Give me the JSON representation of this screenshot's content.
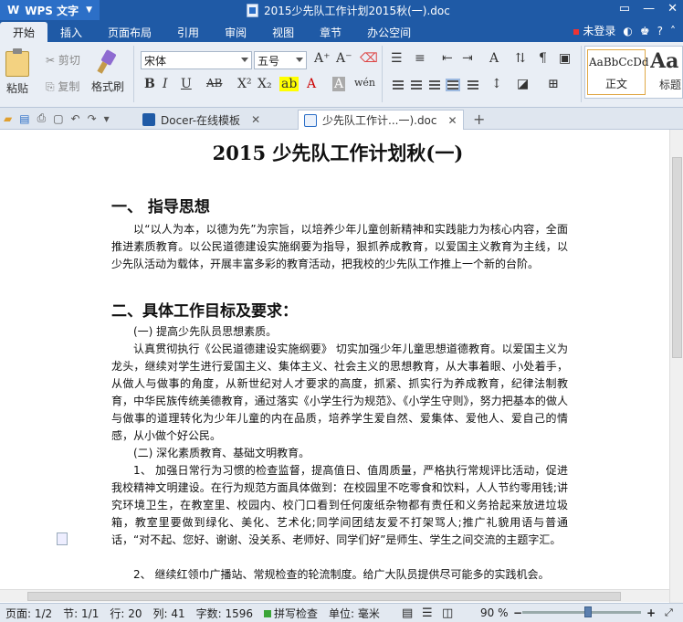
{
  "window": {
    "app_name": "WPS 文字",
    "title": "2015少先队工作计划2015秋(一).doc",
    "login_text": "未登录"
  },
  "menu": {
    "items": [
      "开始",
      "插入",
      "页面布局",
      "引用",
      "审阅",
      "视图",
      "章节",
      "办公空间"
    ]
  },
  "ribbon": {
    "paste": "粘贴",
    "cut": "剪切",
    "copy": "复制",
    "format_painter": "格式刷",
    "font_name": "宋体",
    "font_size": "五号",
    "style_normal_preview": "AaBbCcDd",
    "style_normal_label": "正文",
    "style_heading_preview": "Aa",
    "style_heading_label": "标题"
  },
  "tabs": [
    {
      "label": "Docer-在线模板"
    },
    {
      "label": "少先队工作计...一).doc"
    }
  ],
  "document": {
    "title": "2015 少先队工作计划秋(一)",
    "h1": "一、  指导思想",
    "p1": "以“以人为本，以德为先”为宗旨，以培养少年儿童创新精神和实践能力为核心内容，全面推进素质教育。以公民道德建设实施纲要为指导，狠抓养成教育，以爱国主义教育为主线，以少先队活动为载体，开展丰富多彩的教育活动，把我校的少先队工作推上一个新的台阶。",
    "h2": "二、具体工作目标及要求：",
    "s1": "(一) 提高少先队员思想素质。",
    "p2": "认真贯彻执行《公民道德建设实施纲要》 切实加强少年儿童思想道德教育。以爱国主义为龙头，继续对学生进行爱国主义、集体主义、社会主义的思想教育，从大事着眼、小处着手，从做人与做事的角度，从新世纪对人才要求的高度，抓紧、抓实行为养成教育，纪律法制教育，中华民族传统美德教育，通过落实《小学生行为规范》、《小学生守则》，努力把基本的做人与做事的道理转化为少年儿童的内在品质，培养学生爱自然、爱集体、爱他人、爱自己的情感，从小做个好公民。",
    "s2": "(二) 深化素质教育、基础文明教育。",
    "p3": "1、  加强日常行为习惯的检查监督，提高值日、值周质量，严格执行常规评比活动，促进我校精神文明建设。在行为规范方面具体做到：在校园里不吃零食和饮料，人人节约零用钱;讲究环境卫生，在教室里、校园内、校门口看到任何废纸杂物都有责任和义务拾起来放进垃圾箱，教室里要做到绿化、美化、艺术化;同学间团结友爱不打架骂人;推广礼貌用语与普通话，“对不起、您好、谢谢、没关系、老师好、同学们好”是师生、学生之间交流的主题字汇。",
    "p4": "2、  继续红领巾广播站、常规检查的轮流制度。给广大队员提供尽可能多的实践机会。"
  },
  "status": {
    "page": "页面: 1/2",
    "section": "节: 1/1",
    "row": "行: 20",
    "col": "列: 41",
    "words": "字数: 1596",
    "spellcheck": "拼写检查",
    "unit": "单位: 毫米",
    "zoom": "90 %",
    "zoom_level": 0.9
  }
}
